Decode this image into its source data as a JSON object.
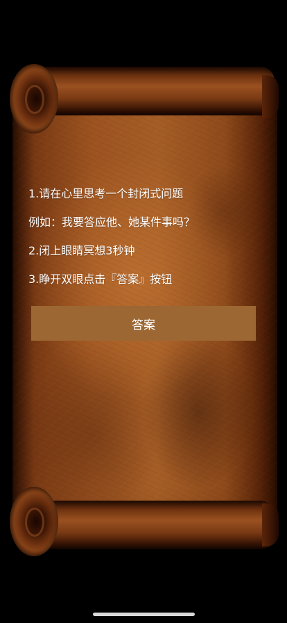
{
  "instructions": {
    "line1": "1.请在心里思考一个封闭式问题",
    "line2": "例如：我要答应他、她某件事吗？",
    "line3": "2.闭上眼睛冥想3秒钟",
    "line4": "3.睁开双眼点击『答案』按钮"
  },
  "answer_button": {
    "label": "答案"
  },
  "colors": {
    "background": "#000000",
    "button": "#9c6733",
    "text": "#ffffff",
    "parchment": "#9c5320"
  }
}
